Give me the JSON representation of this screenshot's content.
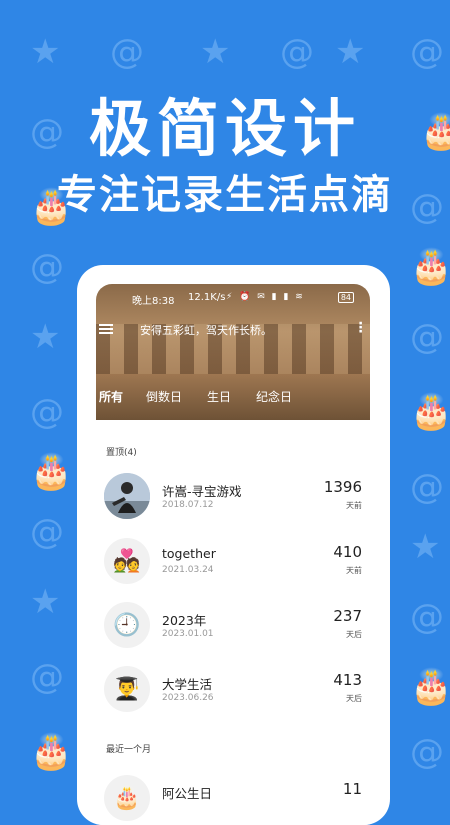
{
  "promo": {
    "headline": "极简设计",
    "subline": "专注记录生活点滴"
  },
  "background_icons": [
    "star-icon",
    "at-sign-icon",
    "cake-icon"
  ],
  "status_bar": {
    "time": "晚上8:38",
    "net_speed": "12.1K/s",
    "icons": "⚡ ⏰ ✉ ▮ ▮ ≋",
    "battery": "84"
  },
  "app": {
    "quote": "安得五彩虹，驾天作长桥。",
    "tabs": [
      {
        "label": "所有",
        "active": true
      },
      {
        "label": "倒数日",
        "active": false
      },
      {
        "label": "生日",
        "active": false
      },
      {
        "label": "纪念日",
        "active": false
      }
    ],
    "pinned_section": "置顶(4)",
    "recent_section": "最近一个月",
    "pinned": [
      {
        "icon": "photo-avatar",
        "name": "许嵩-寻宝游戏",
        "date": "2018.07.12",
        "days": "1396",
        "unit": "天前"
      },
      {
        "icon": "couple-icon",
        "emoji": "💑",
        "name": "together",
        "date": "2021.03.24",
        "days": "410",
        "unit": "天前"
      },
      {
        "icon": "clock-icon",
        "emoji": "🕘",
        "name": "2023年",
        "date": "2023.01.01",
        "days": "237",
        "unit": "天后"
      },
      {
        "icon": "graduate-icon",
        "emoji": "👨‍🎓",
        "name": "大学生活",
        "date": "2023.06.26",
        "days": "413",
        "unit": "天后"
      }
    ],
    "recent": [
      {
        "icon": "birthday-icon",
        "emoji": "🎂",
        "name": "阿公生日",
        "days": "11"
      }
    ]
  }
}
